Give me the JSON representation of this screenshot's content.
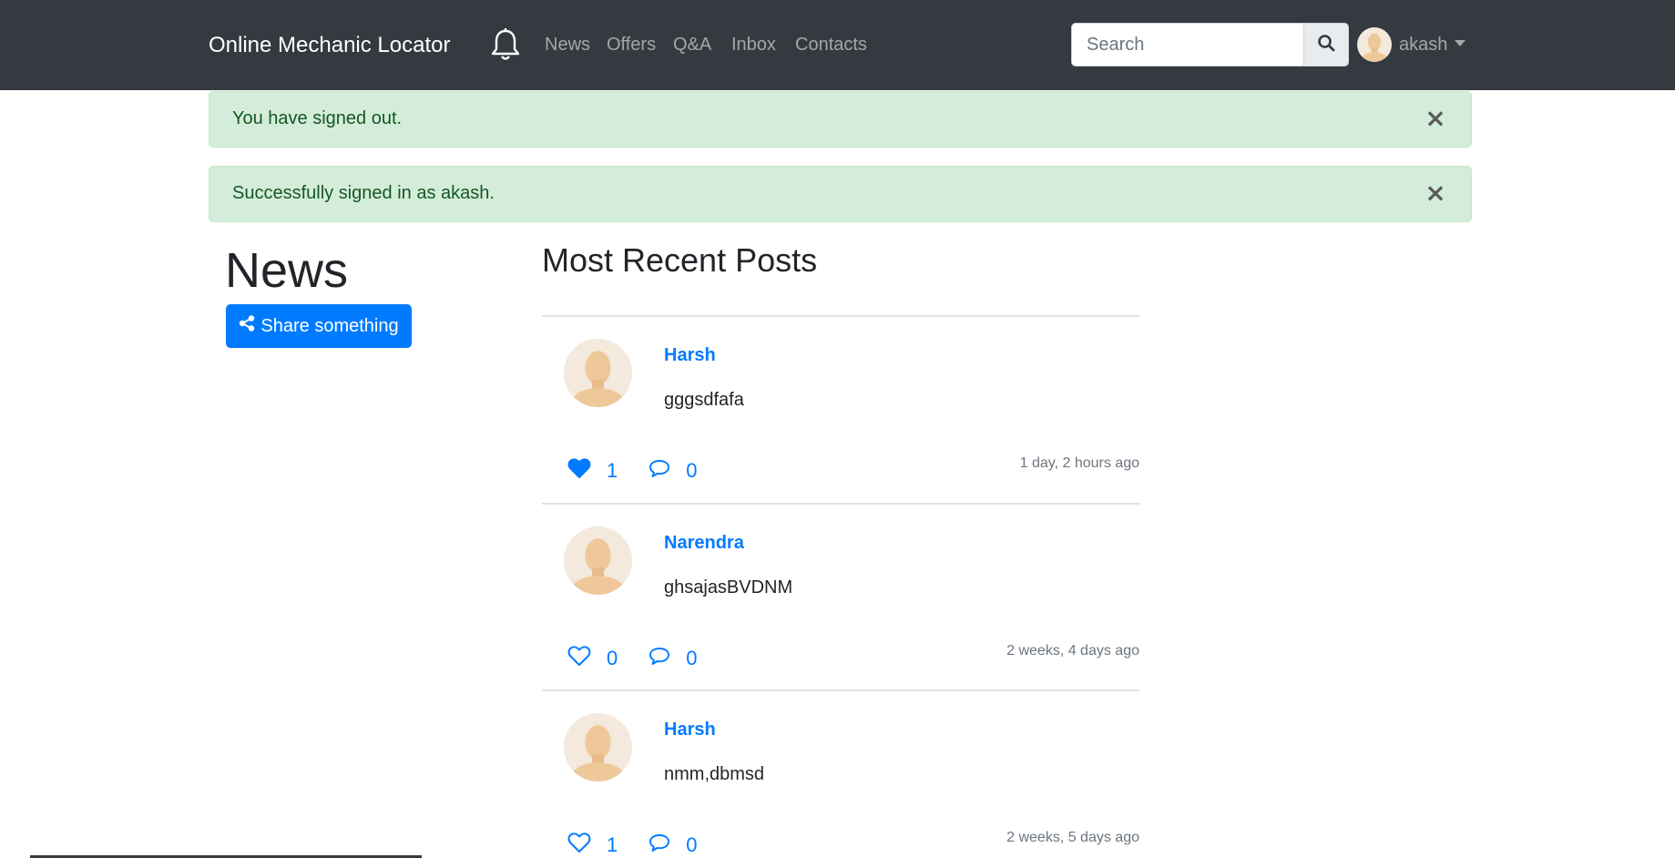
{
  "navbar": {
    "brand": "Online Mechanic Locator",
    "links": [
      "News",
      "Offers",
      "Q&A",
      "Inbox",
      "Contacts"
    ],
    "search_placeholder": "Search",
    "username": "akash"
  },
  "alerts": [
    {
      "text": "You have signed out.",
      "close": "×"
    },
    {
      "text": "Successfully signed in as akash.",
      "close": "×"
    }
  ],
  "sidebar": {
    "heading": "News",
    "share_label": "Share something"
  },
  "main": {
    "heading": "Most Recent Posts",
    "posts": [
      {
        "author": "Harsh",
        "body": "gggsdfafa",
        "likes": "1",
        "liked": true,
        "comments": "0",
        "time": "1 day, 2 hours ago"
      },
      {
        "author": "Narendra",
        "body": "ghsajasBVDNM",
        "likes": "0",
        "liked": false,
        "comments": "0",
        "time": "2 weeks, 4 days ago"
      },
      {
        "author": "Harsh",
        "body": "nmm,dbmsd",
        "likes": "1",
        "liked": false,
        "comments": "0",
        "time": "2 weeks, 5 days ago"
      }
    ]
  },
  "colors": {
    "navbar_bg": "#343a40",
    "primary": "#007bff",
    "alert_bg": "#d4edda",
    "alert_text": "#155724"
  },
  "icons": [
    "bell-icon",
    "search-icon",
    "share-icon",
    "heart-icon",
    "comment-icon",
    "close-icon",
    "avatar"
  ]
}
